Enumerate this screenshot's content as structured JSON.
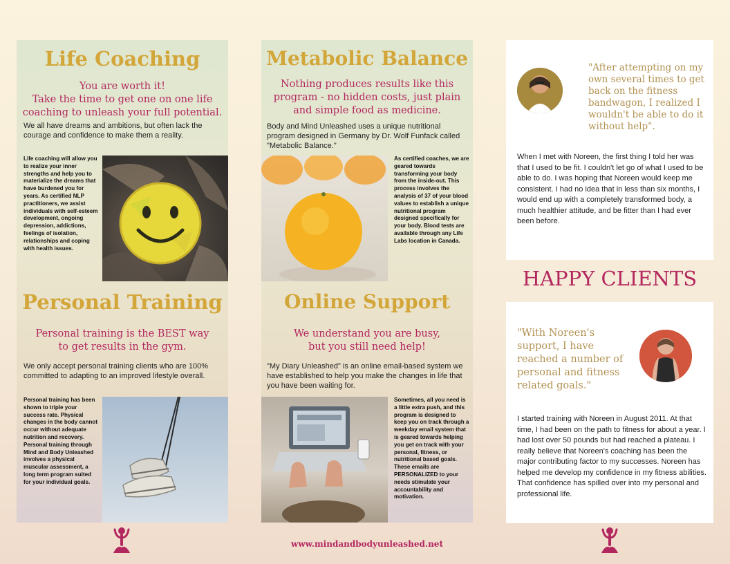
{
  "life_coaching": {
    "title": "Life Coaching",
    "tagline": "You are worth it!\nTake the time to get one on one life coaching to unleash your full potential.",
    "intro": "We all have dreams and ambitions, but often lack the courage and confidence to make them a reality.",
    "body": "Life coaching will allow you to realize your inner strengths and help you to materialize the dreams that have burdened you for years. As certified NLP practitioners, we assist individuals with self-esteem development, ongoing depression, addictions, feelings of isolation, relationships and coping with health issues."
  },
  "personal_training": {
    "title": "Personal Training",
    "tagline": "Personal training is the BEST way to get results in the gym.",
    "intro": "We only accept personal training clients who are 100% committed to adapting to an improved lifestyle overall.",
    "body": "Personal training has been shown to triple your success rate. Physical changes in the body cannot occur without adequate nutrition and recovery. Personal training through Mind and Body Unleashed involves a physical muscular assessment, a long term program suited for your individual goals."
  },
  "metabolic_balance": {
    "title": "Metabolic Balance",
    "tagline": "Nothing produces results like this program - no hidden costs, just plain and simple food as medicine.",
    "intro": "Body and Mind Unleashed uses a unique nutritional program designed in Germany by Dr. Wolf Funfack called \"Metabolic Balance.\"",
    "body": "As certified coaches, we are geared towards transforming your body from the inside-out. This process involves the analysis of 37 of your blood values to establish a unique nutritional program designed specifically for your body. Blood tests are available through any Life Labs location in Canada."
  },
  "online_support": {
    "title": "Online Support",
    "tagline": "We understand you are busy,\nbut you still need help!",
    "intro": "\"My Diary Unleashed\" is an online email-based system we have established to help you make the changes in life that you have been waiting for.",
    "body": "Sometimes, all you need is a little extra push, and this program is designed to keep you on track through a weekday email system that is geared towards helping you get on track with your personal, fitness, or nutritional based goals. These emails are PERSONALIZED to your needs stimulate your accountability and motivation."
  },
  "testimonials": {
    "heading": "HAPPY CLIENTS",
    "first": {
      "quote": "\"After attempting on my own several times to get back on the fitness bandwagon, I realized I wouldn't be able to do it without help\".",
      "story": "When I met with Noreen, the first thing I told her was that I used to be fit. I couldn't let go of what I used to be able to do. I was hoping that Noreen would keep me consistent. I had no idea that in less than six months, I would end up with a completely transformed body, a much healthier attitude, and be fitter than I had ever been before."
    },
    "second": {
      "quote": "\"With Noreen's support, I have reached a number of personal and fitness related goals.\"",
      "story": "I started training with Noreen in August 2011. At that time, I had been on the path to fitness for about a year. I had lost over 50 pounds but had reached a plateau. I really believe that Noreen's coaching has been the major contributing factor to my successes. Noreen has helped me develop my confidence in my fitness abilities. That confidence has spilled over into my personal and professional life."
    }
  },
  "footer": {
    "url": "www.mindandbodyunleashed.net"
  },
  "colors": {
    "gold": "#d3a63a",
    "magenta": "#b3275f",
    "quote_gold": "#b29252"
  },
  "icons": [
    "smiley-leaf-photo",
    "hanging-sneakers-photo",
    "orange-fruit-photo",
    "laptop-hands-photo",
    "yoga-figure-icon",
    "client-avatar"
  ]
}
